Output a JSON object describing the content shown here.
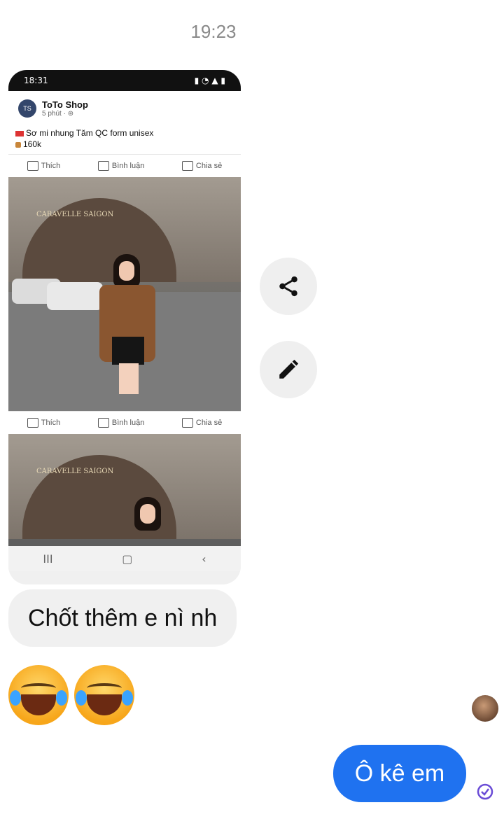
{
  "conversation": {
    "timestamp": "19:23"
  },
  "screenshot": {
    "status_time": "18:31",
    "shop_name": "ToTo Shop",
    "post_time": "5 phút · ⊛",
    "post_line1": "Sơ mi nhung Tăm QC form unisex",
    "post_line2": "160k",
    "actions": {
      "like": "Thích",
      "comment": "Bình luận",
      "share": "Chia sẻ"
    },
    "sign_text": "CARAVELLE SAIGON",
    "nav": {
      "recent": "III",
      "home": "▢",
      "back": "‹"
    }
  },
  "side_actions": {
    "share_icon": "share-icon",
    "edit_icon": "pencil-icon"
  },
  "messages": {
    "incoming_text": "Chốt thêm e nì nh",
    "reaction_emoji": [
      "tears-of-joy-emoji",
      "tears-of-joy-emoji"
    ],
    "outgoing_text": "Ô kê em"
  },
  "colors": {
    "outgoing_bubble": "#1f72f0",
    "incoming_bubble": "#f0f0f0",
    "timestamp": "#8a8a8a"
  }
}
